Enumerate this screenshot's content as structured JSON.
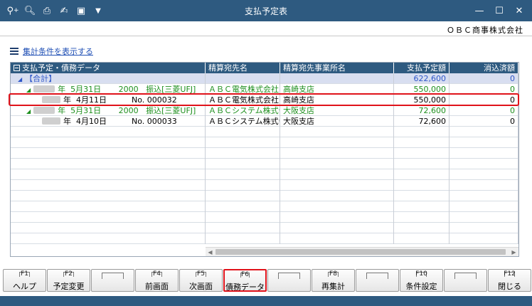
{
  "window": {
    "title": "支払予定表",
    "company": "ＯＢＣ商事株式会社",
    "toolbar_icons": [
      "search-plus-icon",
      "zoom-icon",
      "print-icon",
      "calc-icon",
      "excel-export-icon",
      "dropdown-icon"
    ],
    "controls": {
      "minimize": "—",
      "maximize": "☐",
      "close": "✕"
    }
  },
  "condition_link": "集計条件を表示する",
  "grid": {
    "columns": [
      "支払予定・債務データ",
      "精算宛先名",
      "精算宛先事業所名",
      "支払予定額",
      "消込済額"
    ],
    "rows": [
      {
        "type": "total",
        "label": "【合計】",
        "dest": "",
        "office": "",
        "amount": "622,600",
        "cleared": "0"
      },
      {
        "type": "group",
        "year_label": "年",
        "date": "5月31日",
        "code": "2000",
        "method": "振込[三菱UFJ]",
        "dest": "ＡＢＣ電気株式会社",
        "office": "高崎支店",
        "amount": "550,000",
        "cleared": "0"
      },
      {
        "type": "detail",
        "year_label": "年",
        "date": "4月11日",
        "no": "No. 000032",
        "dest": "ＡＢＣ電気株式会社",
        "office": "高崎支店",
        "amount": "550,000",
        "cleared": "0"
      },
      {
        "type": "group",
        "year_label": "年",
        "date": "5月31日",
        "code": "2000",
        "method": "振込[三菱UFJ]",
        "dest": "ＡＢＣシステム株式会",
        "office": "大阪支店",
        "amount": "72,600",
        "cleared": "0"
      },
      {
        "type": "detail",
        "year_label": "年",
        "date": "4月10日",
        "no": "No. 000033",
        "dest": "ＡＢＣシステム株式会",
        "office": "大阪支店",
        "amount": "72,600",
        "cleared": "0"
      }
    ]
  },
  "fkeys": [
    {
      "key": "F1",
      "label": "ヘルプ"
    },
    {
      "key": "F2",
      "label": "予定変更"
    },
    {
      "key": "",
      "label": ""
    },
    {
      "key": "F4",
      "label": "前画面"
    },
    {
      "key": "F5",
      "label": "次画面"
    },
    {
      "key": "F6",
      "label": "債務データ"
    },
    {
      "key": "",
      "label": ""
    },
    {
      "key": "F8",
      "label": "再集計"
    },
    {
      "key": "",
      "label": ""
    },
    {
      "key": "F10",
      "label": "条件設定"
    },
    {
      "key": "",
      "label": ""
    },
    {
      "key": "F12",
      "label": "閉じる"
    }
  ],
  "colors": {
    "titlebar": "#2e5a80",
    "highlight": "#e0131b",
    "green_text": "#1e8f1e",
    "total_text": "#2f57c9",
    "total_row": "#d8def0"
  }
}
